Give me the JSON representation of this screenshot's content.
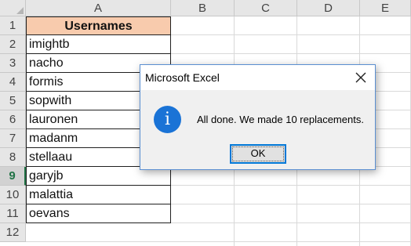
{
  "spreadsheet": {
    "columns": [
      "A",
      "B",
      "C",
      "D",
      "E"
    ],
    "rows": [
      "1",
      "2",
      "3",
      "4",
      "5",
      "6",
      "7",
      "8",
      "9",
      "10",
      "11",
      "12"
    ],
    "active_row": "9",
    "cells": {
      "header": "Usernames",
      "usernames": [
        "imightb",
        "nacho",
        "formis",
        "sopwith",
        "lauronen",
        "madanm",
        "stellaau",
        "garyjb",
        "malattia",
        "oevans"
      ]
    },
    "colors": {
      "header_fill": "#f8cbad",
      "accent": "#217346"
    }
  },
  "dialog": {
    "title": "Microsoft Excel",
    "message": "All done. We made 10 replacements.",
    "icon": "info-icon",
    "ok_label": "OK",
    "close_icon": "close-icon",
    "colors": {
      "icon": "#1a73d6",
      "button_border": "#0078d7"
    }
  }
}
